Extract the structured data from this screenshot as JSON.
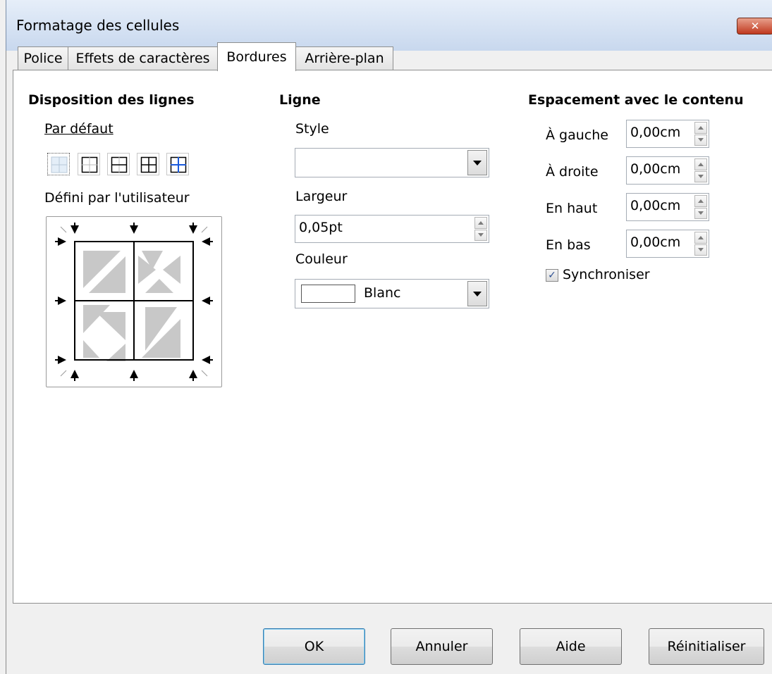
{
  "window": {
    "title": "Formatage des cellules",
    "close_label": "✕"
  },
  "tabs": [
    {
      "label": "Police",
      "active": false
    },
    {
      "label": "Effets de caractères",
      "active": false
    },
    {
      "label": "Bordures",
      "active": true
    },
    {
      "label": "Arrière-plan",
      "active": false
    }
  ],
  "line_arrangement": {
    "heading": "Disposition des lignes",
    "default_label": "Par défaut",
    "user_defined_label": "Défini par l'utilisateur"
  },
  "line": {
    "heading": "Ligne",
    "style_label": "Style",
    "style_value": "",
    "width_label": "Largeur",
    "width_value": "0,05pt",
    "color_label": "Couleur",
    "color_value": "Blanc",
    "color_swatch": "#ffffff"
  },
  "spacing": {
    "heading": "Espacement avec le contenu",
    "left_label": "À gauche",
    "left_value": "0,00cm",
    "right_label": "À droite",
    "right_value": "0,00cm",
    "top_label": "En haut",
    "top_value": "0,00cm",
    "bottom_label": "En bas",
    "bottom_value": "0,00cm",
    "sync_label": "Synchroniser",
    "sync_checked": true
  },
  "buttons": {
    "ok": "OK",
    "cancel": "Annuler",
    "help": "Aide",
    "reset": "Réinitialiser"
  }
}
